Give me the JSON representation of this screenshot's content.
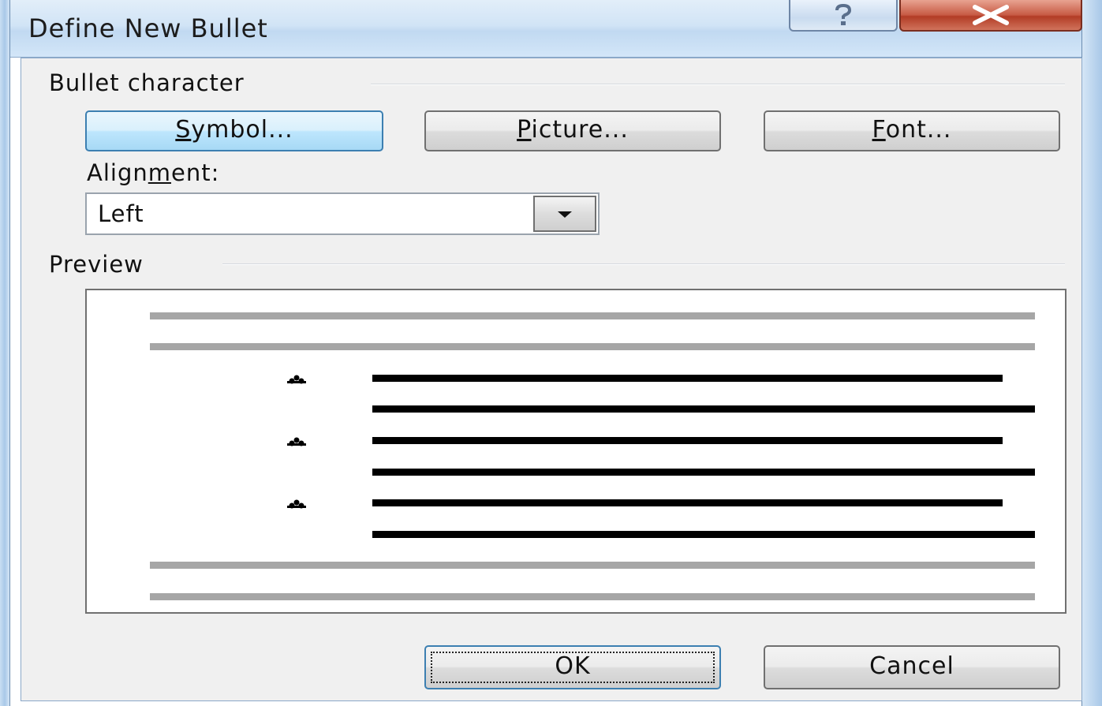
{
  "window": {
    "title": "Define New Bullet",
    "help_glyph": "?",
    "close_glyph": "✕"
  },
  "bullet_character": {
    "group_label": "Bullet character",
    "symbol_button": {
      "prefix": "",
      "mnemonic": "S",
      "suffix": "ymbol..."
    },
    "picture_button": {
      "prefix": "",
      "mnemonic": "P",
      "suffix": "icture..."
    },
    "font_button": {
      "prefix": "",
      "mnemonic": "F",
      "suffix": "ont..."
    }
  },
  "alignment": {
    "label_prefix": "Align",
    "label_mnemonic": "m",
    "label_suffix": "ent:",
    "selected": "Left"
  },
  "preview": {
    "group_label": "Preview",
    "bullet_icon": "club-bullet-icon"
  },
  "footer": {
    "ok_label": "OK",
    "cancel_label": "Cancel"
  },
  "colors": {
    "title_bar": "#d1e4f6",
    "close_button": "#c75a44",
    "focus_border": "#3c7fb1",
    "dialog_background": "#f0f0f0"
  }
}
